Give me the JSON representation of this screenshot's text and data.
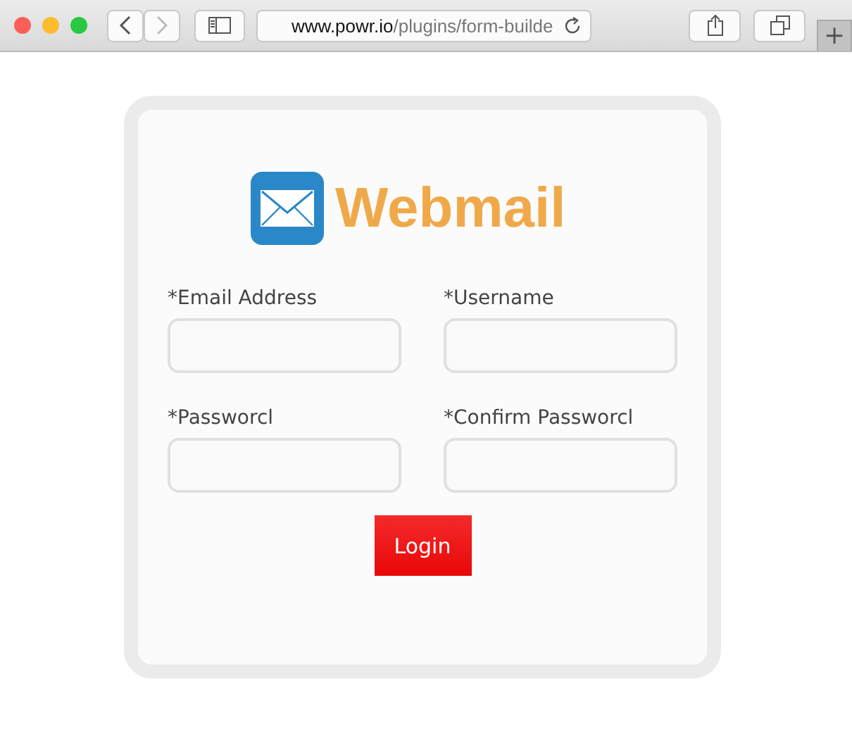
{
  "browser": {
    "url_host": "www.powr.io",
    "url_path": "/plugins/form-builde",
    "new_tab": "+"
  },
  "logo": {
    "text": "Webmail"
  },
  "fields": [
    {
      "label": "*Email Address"
    },
    {
      "label": "*Username"
    },
    {
      "label": "*Passworcl"
    },
    {
      "label": "*Confirm Passworcl"
    }
  ],
  "submit": {
    "label": "Login"
  }
}
